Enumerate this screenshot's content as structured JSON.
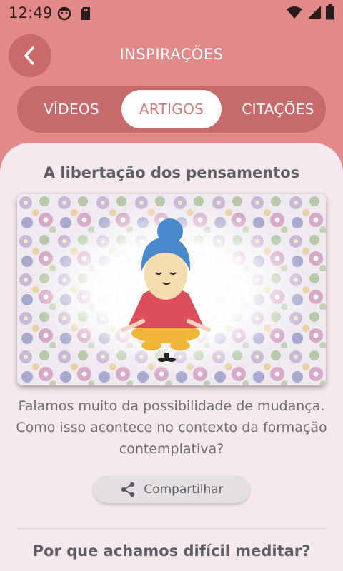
{
  "status_bar": {
    "time": "12:49"
  },
  "header": {
    "title": "INSPIRAÇÕES"
  },
  "tabs": [
    {
      "label": "VÍDEOS"
    },
    {
      "label": "ARTIGOS"
    },
    {
      "label": "CITAÇÕES"
    }
  ],
  "articles": [
    {
      "title": "A libertação dos pensamentos",
      "description": "Falamos muito da possibilidade de mudança. Como isso acontece no contexto da formação contemplativa?",
      "share_label": "Compartilhar"
    },
    {
      "title": "Por que achamos difícil meditar?"
    }
  ],
  "colors": {
    "header_bg": "#e2898a",
    "tabs_bg": "#c66a6c",
    "active_tab_text": "#d37a7d",
    "content_bg": "#f6e9ee"
  }
}
